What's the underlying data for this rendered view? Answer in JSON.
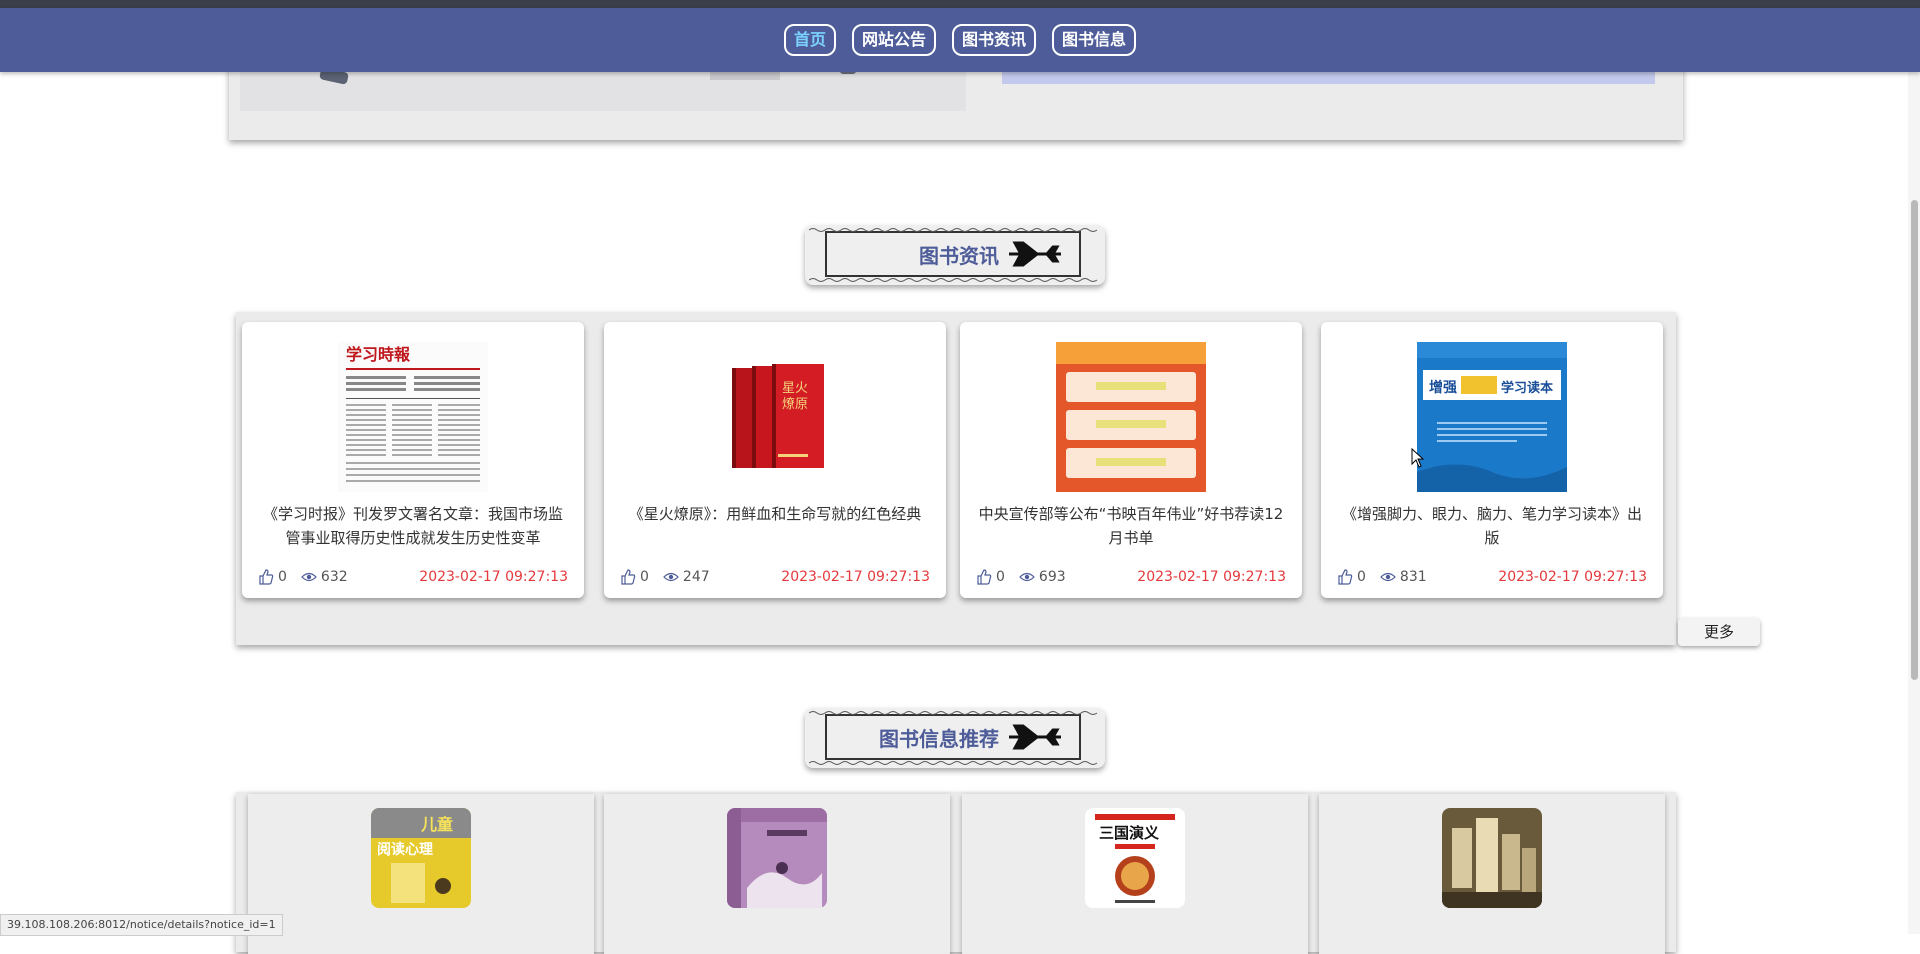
{
  "nav": {
    "items": [
      {
        "label": "首页",
        "active": true
      },
      {
        "label": "网站公告",
        "active": false
      },
      {
        "label": "图书资讯",
        "active": false
      },
      {
        "label": "图书信息",
        "active": false
      }
    ]
  },
  "sections": {
    "news_title": "图书资讯",
    "books_title": "图书信息推荐"
  },
  "news": [
    {
      "title": "《学习时报》刊发罗文署名文章：我国市场监管事业取得历史性成就发生历史性变革",
      "likes": "0",
      "views": "632",
      "date": "2023-02-17 09:27:13",
      "thumb": "newspaper"
    },
    {
      "title": "《星火燎原》：用鲜血和生命写就的红色经典",
      "likes": "0",
      "views": "247",
      "date": "2023-02-17 09:27:13",
      "thumb": "red-books"
    },
    {
      "title": "中央宣传部等公布“书映百年伟业”好书荐读12月书单",
      "likes": "0",
      "views": "693",
      "date": "2023-02-17 09:27:13",
      "thumb": "orange-list"
    },
    {
      "title": "《增强脚力、眼力、脑力、笔力学习读本》出版",
      "likes": "0",
      "views": "831",
      "date": "2023-02-17 09:27:13",
      "thumb": "blue-book"
    }
  ],
  "more_label": "更多",
  "books": [
    {
      "name": "",
      "cover": "yellow"
    },
    {
      "name": "",
      "cover": "purple"
    },
    {
      "name": "",
      "cover": "sanguo"
    },
    {
      "name": "",
      "cover": "stacks"
    }
  ],
  "status_url": "39.108.108.206:8012/notice/details?notice_id=1",
  "colors": {
    "nav_bg": "#4e5d99",
    "accent_title": "#4e5d99",
    "date": "#e4393c"
  }
}
